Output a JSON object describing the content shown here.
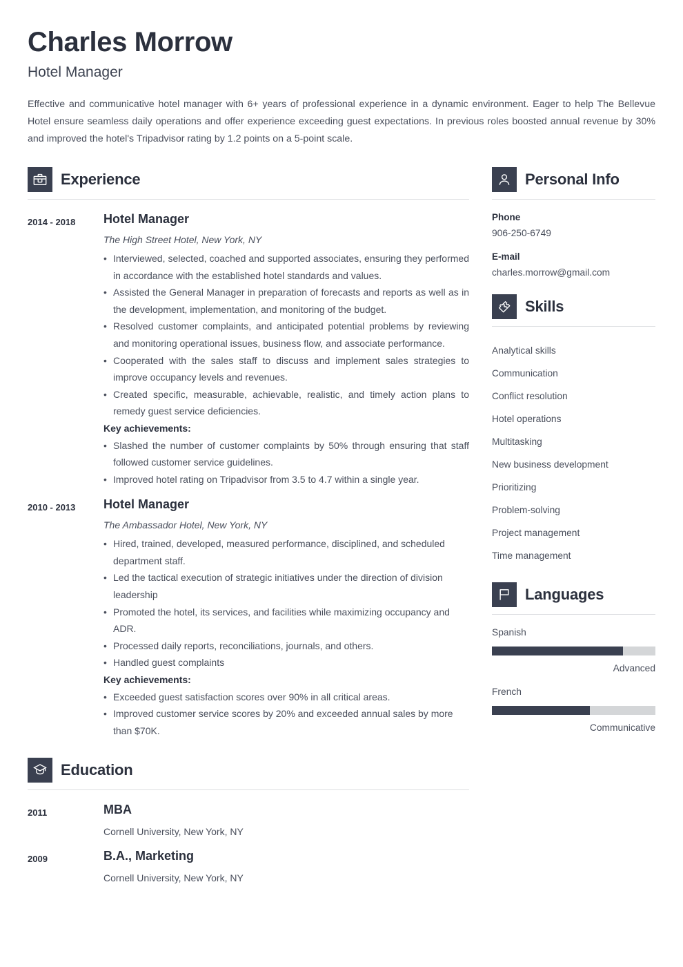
{
  "header": {
    "name": "Charles Morrow",
    "job_title": "Hotel Manager",
    "summary": "Effective and communicative hotel manager with 6+ years of professional experience in a dynamic environment. Eager to help The Bellevue Hotel ensure seamless daily operations and offer experience exceeding guest expectations. In previous roles boosted annual revenue by 30% and improved the hotel's Tripadvisor rating by 1.2 points on a 5-point scale."
  },
  "theme": {
    "accent": "#3a4050",
    "heading_color": "#2b303d",
    "body_color": "#4a4f5c",
    "rule_color": "#dcdee1",
    "bar_track_color": "#d4d6d8"
  },
  "sections": {
    "experience": {
      "title": "Experience",
      "icon": "briefcase-icon",
      "entries": [
        {
          "date": "2014 - 2018",
          "role": "Hotel Manager",
          "org": "The High Street Hotel, New York, NY",
          "bullets": [
            "Interviewed, selected, coached and supported associates, ensuring they performed in accordance with the established hotel standards and values.",
            "Assisted the General Manager in preparation of forecasts and reports as well as in the development, implementation, and monitoring of the budget.",
            "Resolved customer complaints, and anticipated potential problems by reviewing and monitoring operational issues, business flow, and associate performance.",
            "Cooperated with the sales staff to discuss and implement sales strategies to improve occupancy levels and revenues.",
            "Created specific, measurable, achievable, realistic, and timely action plans to remedy guest service deficiencies."
          ],
          "key_achievements_label": "Key achievements:",
          "achievements": [
            "Slashed the number of customer complaints by 50% through ensuring that staff followed customer service guidelines.",
            "Improved hotel rating on Tripadvisor from 3.5 to 4.7 within a single year."
          ]
        },
        {
          "date": "2010 - 2013",
          "role": "Hotel Manager",
          "org": "The Ambassador Hotel, New York, NY",
          "bullets": [
            "Hired, trained, developed, measured performance, disciplined, and scheduled department staff.",
            "Led the tactical execution of strategic initiatives under the direction of division leadership",
            "Promoted the hotel, its services, and facilities while maximizing occupancy and ADR.",
            "Processed daily reports, reconciliations, journals, and others.",
            "Handled guest complaints"
          ],
          "key_achievements_label": "Key achievements:",
          "achievements": [
            "Exceeded guest satisfaction scores over 90% in all critical areas.",
            "Improved customer service scores by 20% and exceeded annual sales by more than $70K."
          ]
        }
      ]
    },
    "education": {
      "title": "Education",
      "icon": "graduation-cap-icon",
      "entries": [
        {
          "date": "2011",
          "degree": "MBA",
          "school": "Cornell University, New York, NY"
        },
        {
          "date": "2009",
          "degree": "B.A., Marketing",
          "school": "Cornell University, New York, NY"
        }
      ]
    },
    "personal_info": {
      "title": "Personal Info",
      "icon": "person-icon",
      "fields": [
        {
          "label": "Phone",
          "value": "906-250-6749"
        },
        {
          "label": "E-mail",
          "value": "charles.morrow@gmail.com"
        }
      ]
    },
    "skills": {
      "title": "Skills",
      "icon": "puzzle-piece-icon",
      "items": [
        "Analytical skills",
        "Communication",
        "Conflict resolution",
        "Hotel operations",
        "Multitasking",
        "New business development",
        "Prioritizing",
        "Problem-solving",
        "Project management",
        "Time management"
      ]
    },
    "languages": {
      "title": "Languages",
      "icon": "flag-icon",
      "items": [
        {
          "name": "Spanish",
          "level": "Advanced",
          "percent": 80
        },
        {
          "name": "French",
          "level": "Communicative",
          "percent": 60
        }
      ]
    }
  }
}
